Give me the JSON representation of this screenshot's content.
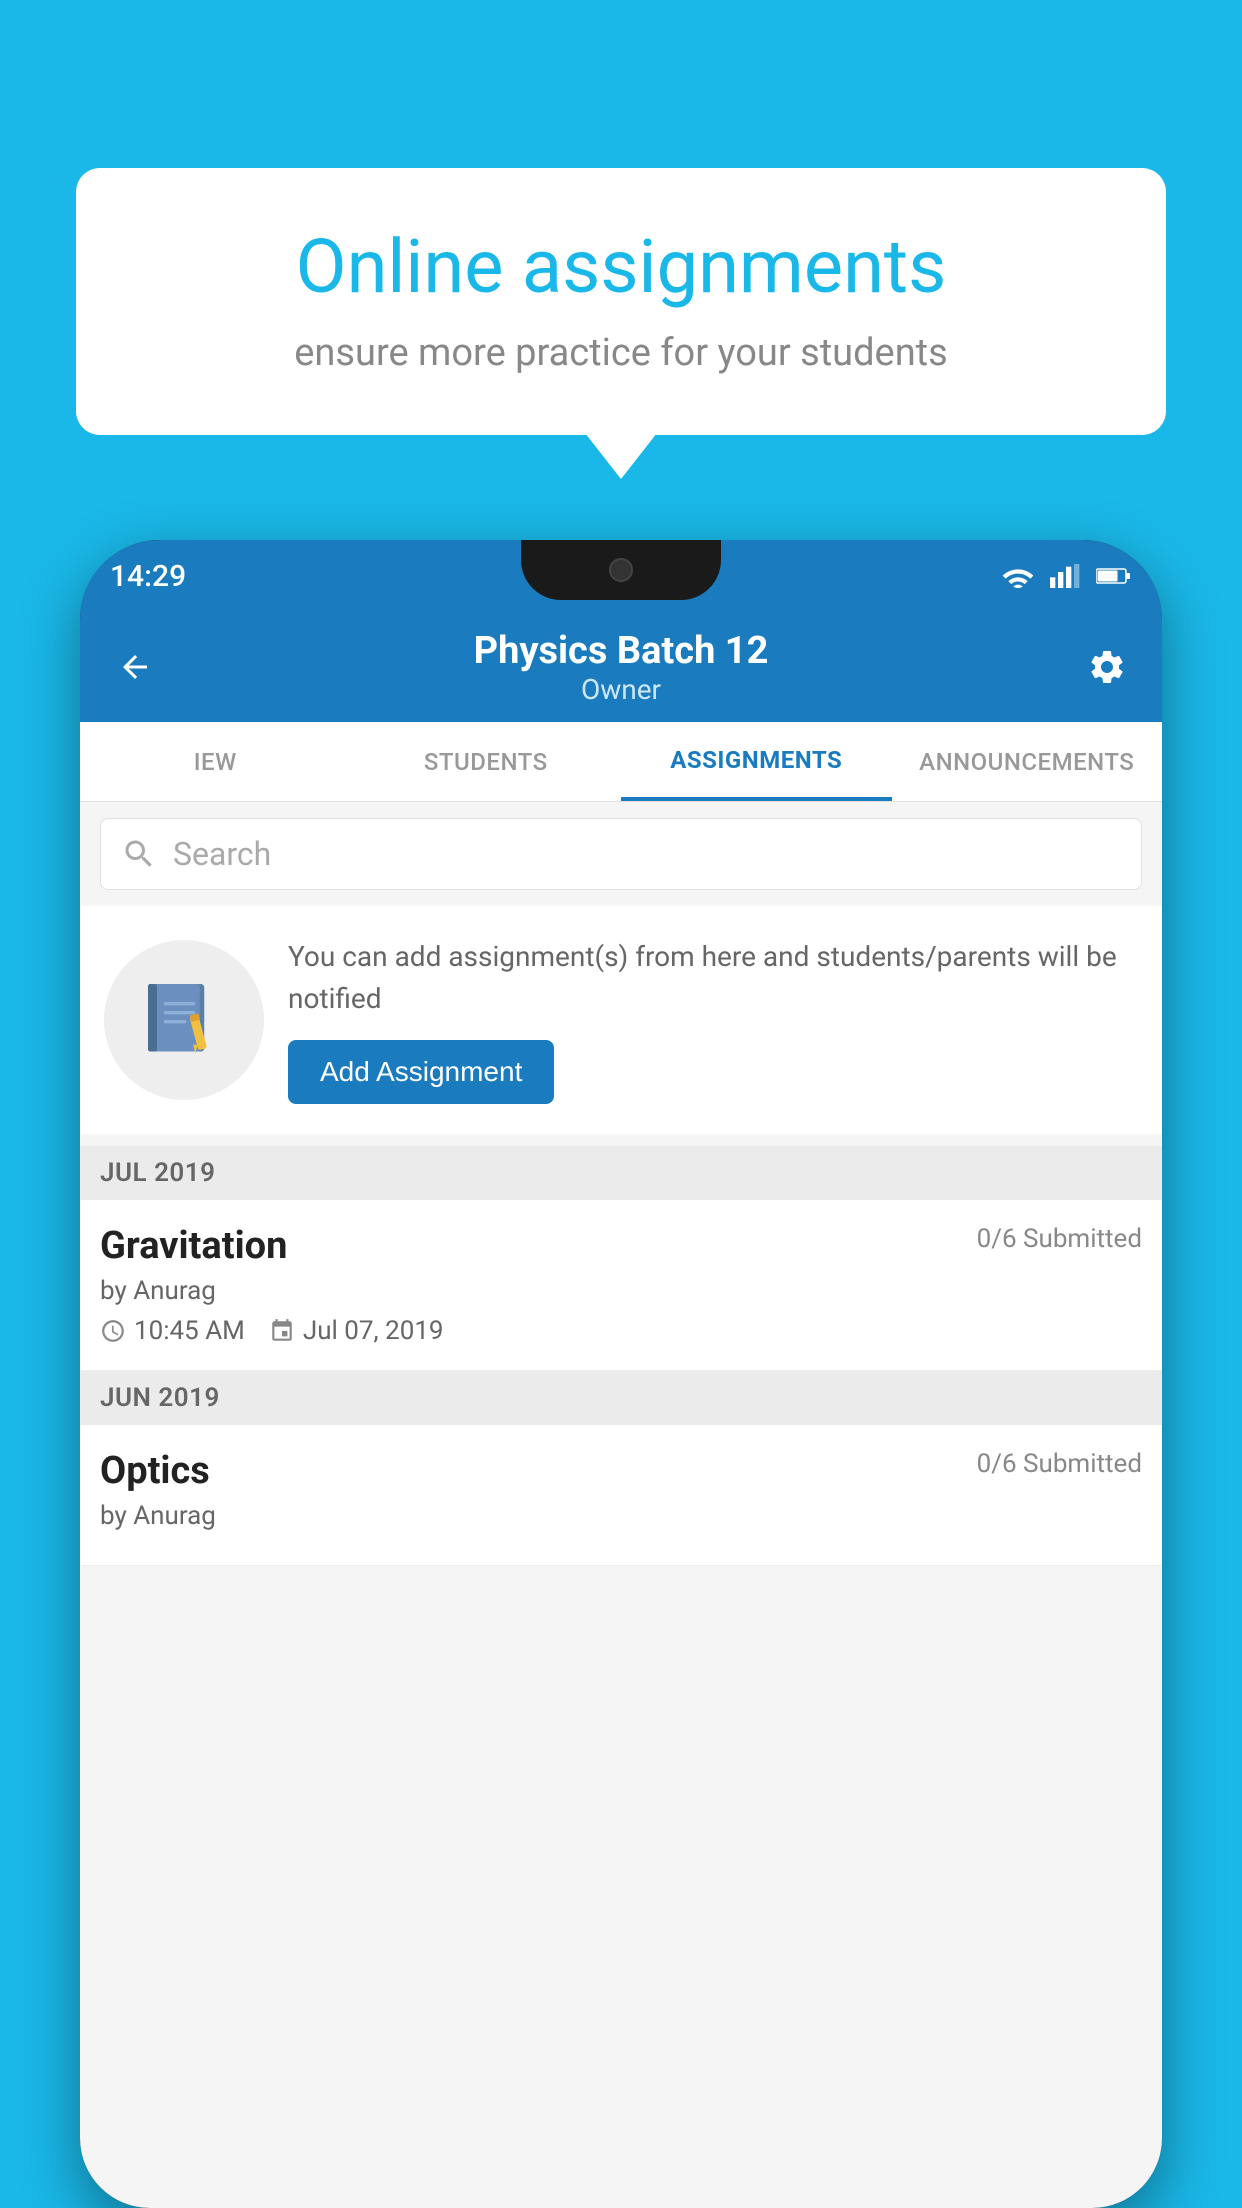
{
  "background_color": "#1ab8e8",
  "speech_bubble": {
    "title": "Online assignments",
    "subtitle": "ensure more practice for your students"
  },
  "status_bar": {
    "time": "14:29"
  },
  "header": {
    "title": "Physics Batch 12",
    "subtitle": "Owner",
    "back_label": "back"
  },
  "tabs": [
    {
      "id": "iew",
      "label": "IEW",
      "active": false
    },
    {
      "id": "students",
      "label": "STUDENTS",
      "active": false
    },
    {
      "id": "assignments",
      "label": "ASSIGNMENTS",
      "active": true
    },
    {
      "id": "announcements",
      "label": "ANNOUNCEMENTS",
      "active": false
    }
  ],
  "search": {
    "placeholder": "Search"
  },
  "empty_state": {
    "message": "You can add assignment(s) from here and students/parents will be notified",
    "add_button_label": "Add Assignment"
  },
  "sections": [
    {
      "header": "JUL 2019",
      "assignments": [
        {
          "name": "Gravitation",
          "submitted": "0/6 Submitted",
          "author": "by Anurag",
          "time": "10:45 AM",
          "date": "Jul 07, 2019"
        }
      ]
    },
    {
      "header": "JUN 2019",
      "assignments": [
        {
          "name": "Optics",
          "submitted": "0/6 Submitted",
          "author": "by Anurag",
          "time": "",
          "date": ""
        }
      ]
    }
  ]
}
